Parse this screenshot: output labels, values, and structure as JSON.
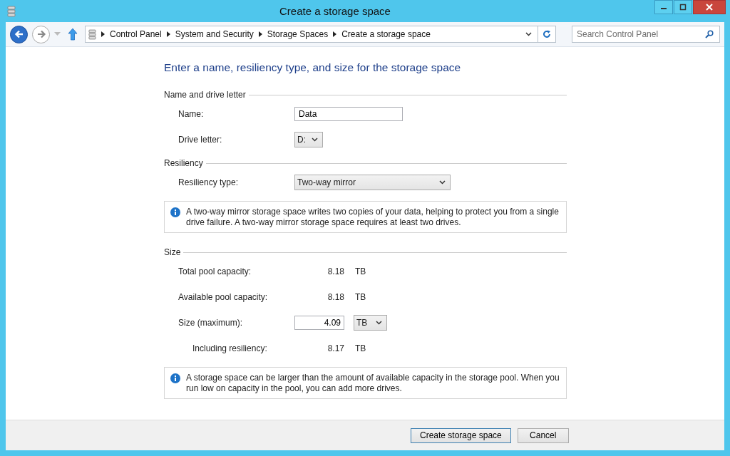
{
  "window": {
    "title": "Create a storage space"
  },
  "address_bar": {
    "breadcrumbs": [
      "Control Panel",
      "System and Security",
      "Storage Spaces",
      "Create a storage space"
    ]
  },
  "search": {
    "placeholder": "Search Control Panel"
  },
  "heading": "Enter a name, resiliency type, and size for the storage space",
  "sections": [
    {
      "title": "Name and drive letter",
      "rows": [
        {
          "kind": "text",
          "label": "Name:",
          "value": "Data"
        },
        {
          "kind": "short-select",
          "label": "Drive letter:",
          "value": "D:"
        }
      ]
    },
    {
      "title": "Resiliency",
      "rows": [
        {
          "kind": "wide-select",
          "label": "Resiliency type:",
          "value": "Two-way mirror"
        }
      ],
      "info": "A two-way mirror storage space writes two copies of your data, helping to protect you from a single drive failure. A two-way mirror storage space requires at least two drives."
    },
    {
      "title": "Size",
      "rows": [
        {
          "kind": "reading",
          "label": "Total pool capacity:",
          "value": "8.18",
          "unit": "TB"
        },
        {
          "kind": "reading",
          "label": "Available pool capacity:",
          "value": "8.18",
          "unit": "TB"
        },
        {
          "kind": "number",
          "label": "Size (maximum):",
          "value": "4.09",
          "unit": "TB"
        },
        {
          "kind": "sub-reading",
          "label": "Including resiliency:",
          "value": "8.17",
          "unit": "TB"
        }
      ],
      "info": "A storage space can be larger than the amount of available capacity in the storage pool. When you run low on capacity in the pool, you can add more drives."
    }
  ],
  "buttons": [
    "Create storage space",
    "Cancel"
  ]
}
